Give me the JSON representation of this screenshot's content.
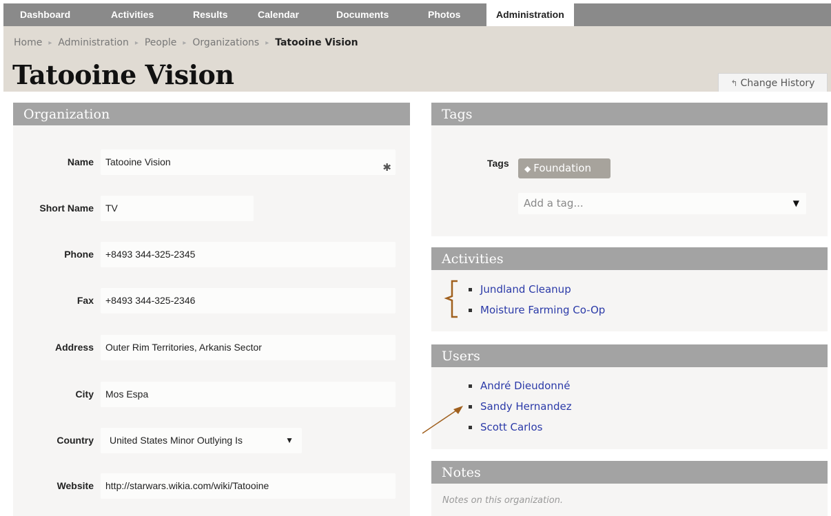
{
  "nav": {
    "tabs": [
      {
        "label": "Dashboard"
      },
      {
        "label": "Activities"
      },
      {
        "label": "Results"
      },
      {
        "label": "Calendar"
      },
      {
        "label": "Documents"
      },
      {
        "label": "Photos"
      },
      {
        "label": "Administration",
        "active": true
      }
    ]
  },
  "breadcrumb": {
    "items": [
      "Home",
      "Administration",
      "People",
      "Organizations"
    ],
    "current": "Tatooine Vision"
  },
  "page": {
    "title": "Tatooine Vision",
    "history_button": "Change History"
  },
  "organization": {
    "heading": "Organization",
    "fields": [
      {
        "label": "Name",
        "value": "Tatooine Vision"
      },
      {
        "label": "Short Name",
        "value": "TV"
      },
      {
        "label": "Phone",
        "value": "+8493 344-325-2345"
      },
      {
        "label": "Fax",
        "value": "+8493 344-325-2346"
      },
      {
        "label": "Address",
        "value": "Outer Rim Territories, Arkanis Sector"
      },
      {
        "label": "City",
        "value": "Mos Espa"
      },
      {
        "label": "Country",
        "value": "United States Minor Outlying Is"
      },
      {
        "label": "Website",
        "value": "http://starwars.wikia.com/wiki/Tatooine"
      }
    ]
  },
  "tags": {
    "heading": "Tags",
    "label": "Tags",
    "items": [
      "Foundation"
    ],
    "placeholder": "Add a tag..."
  },
  "activities": {
    "heading": "Activities",
    "items": [
      "Jundland Cleanup",
      "Moisture Farming Co-Op"
    ]
  },
  "users": {
    "heading": "Users",
    "items": [
      "André Dieudonné",
      "Sandy Hernandez",
      "Scott Carlos"
    ]
  },
  "notes": {
    "heading": "Notes",
    "placeholder": "Notes on this organization."
  },
  "colors": {
    "nav_bg": "#8a8a8a",
    "header_bg": "#e0dbd3",
    "panel_head": "#a3a3a3",
    "link": "#2b3aa8",
    "annotation": "#a0601e"
  }
}
